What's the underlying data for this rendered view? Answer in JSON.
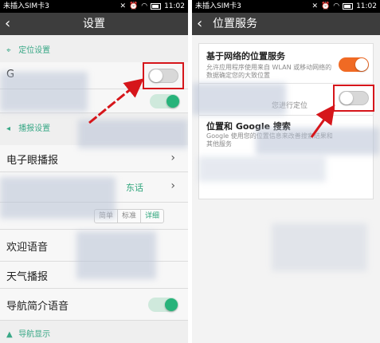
{
  "left": {
    "status": {
      "carrier": "未插入SIM卡3",
      "time": "11:02"
    },
    "title": "设置",
    "section_location": "定位设置",
    "gps_partial": "G",
    "section_voice": "播报设置",
    "row_electronic_eye": "电子眼播报",
    "voice_value": "东话",
    "pill_standard": "标准",
    "pill_detailed": "详细",
    "pill_simple": "简单",
    "row_welcome_voice": "欢迎语音",
    "row_weather": "天气播报",
    "row_nav_intro": "导航简介语音",
    "section_nav_display": "导航显示"
  },
  "right": {
    "status": {
      "carrier": "未插入SIM卡3",
      "time": "11:02"
    },
    "title": "位置服务",
    "network_title": "基于网络的位置服务",
    "network_desc": "允许应用程序使用来自 WLAN 或移动网络的数据确定您的大致位置",
    "gps_desc_partial": "您进行定位",
    "google_title": "位置和 Google 搜索",
    "google_desc": "Google 使用您的位置信息来改善搜索结果和其他服务"
  },
  "colors": {
    "accent_green": "#27b37a",
    "accent_orange": "#f06a24",
    "highlight_red": "#d6161b"
  }
}
